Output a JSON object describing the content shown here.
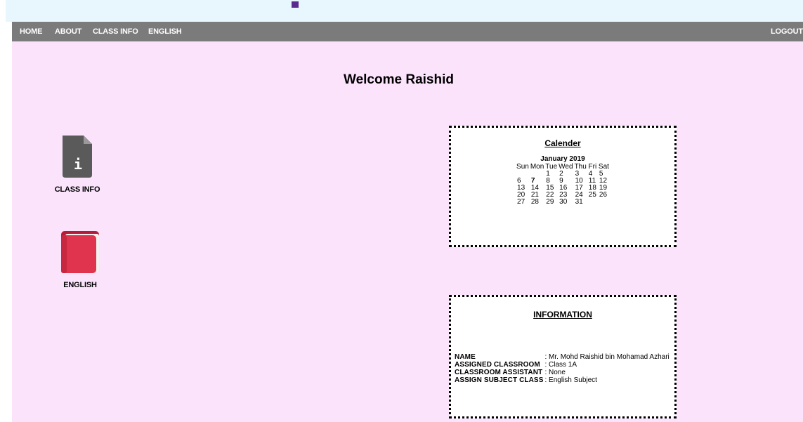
{
  "nav": {
    "home": "HOME",
    "about": "ABOUT",
    "class_info": "CLASS INFO",
    "english": "ENGLISH",
    "logout": "LOGOUT"
  },
  "welcome": "Welcome Raishid",
  "tiles": {
    "class_info": {
      "label": "CLASS INFO",
      "icon": "info-document-icon",
      "icon_glyph": "i"
    },
    "english": {
      "label": "ENGLISH",
      "icon": "book-icon"
    }
  },
  "calendar": {
    "title": "Calender",
    "month": "January 2019",
    "days": [
      "Sun",
      "Mon",
      "Tue",
      "Wed",
      "Thu",
      "Fri",
      "Sat"
    ],
    "weeks": [
      [
        "",
        "",
        "1",
        "2",
        "3",
        "4",
        "5"
      ],
      [
        "6",
        "7",
        "8",
        "9",
        "10",
        "11",
        "12"
      ],
      [
        "13",
        "14",
        "15",
        "16",
        "17",
        "18",
        "19"
      ],
      [
        "20",
        "21",
        "22",
        "23",
        "24",
        "25",
        "26"
      ],
      [
        "27",
        "28",
        "29",
        "30",
        "31",
        "",
        ""
      ]
    ],
    "today": "7"
  },
  "information": {
    "title": "INFORMATION",
    "rows": [
      {
        "label": "NAME",
        "value": ": Mr. Mohd Raishid bin Mohamad Azhari"
      },
      {
        "label": "ASSIGNED CLASSROOM",
        "value": ": Class 1A"
      },
      {
        "label": "CLASSROOM ASSISTANT",
        "value": ": None"
      },
      {
        "label": "ASSIGN SUBJECT CLASS",
        "value": ": English Subject"
      }
    ]
  },
  "colors": {
    "navbar": "#7b7b7b",
    "background": "#fbe3fc",
    "top_strip": "#e8f6fd"
  }
}
